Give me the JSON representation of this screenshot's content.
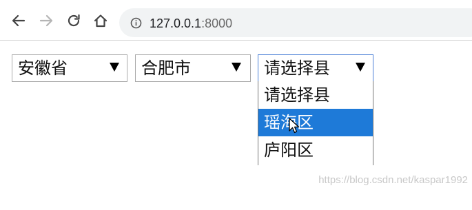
{
  "browser": {
    "back_icon": "arrow-left-icon",
    "forward_icon": "arrow-right-icon",
    "reload_icon": "reload-icon",
    "home_icon": "home-icon",
    "info_icon": "info-icon",
    "url_host": "127.0.0.1",
    "url_port": ":8000"
  },
  "selects": {
    "province": {
      "value": "安徽省"
    },
    "city": {
      "value": "合肥市"
    },
    "county": {
      "value": "请选择县",
      "options": [
        "请选择县",
        "瑶海区",
        "庐阳区"
      ],
      "highlighted_index": 1
    }
  },
  "colors": {
    "highlight": "#1e7ad8",
    "focus_border": "#4a7fd6"
  },
  "watermark": "https://blog.csdn.net/kaspar1992"
}
